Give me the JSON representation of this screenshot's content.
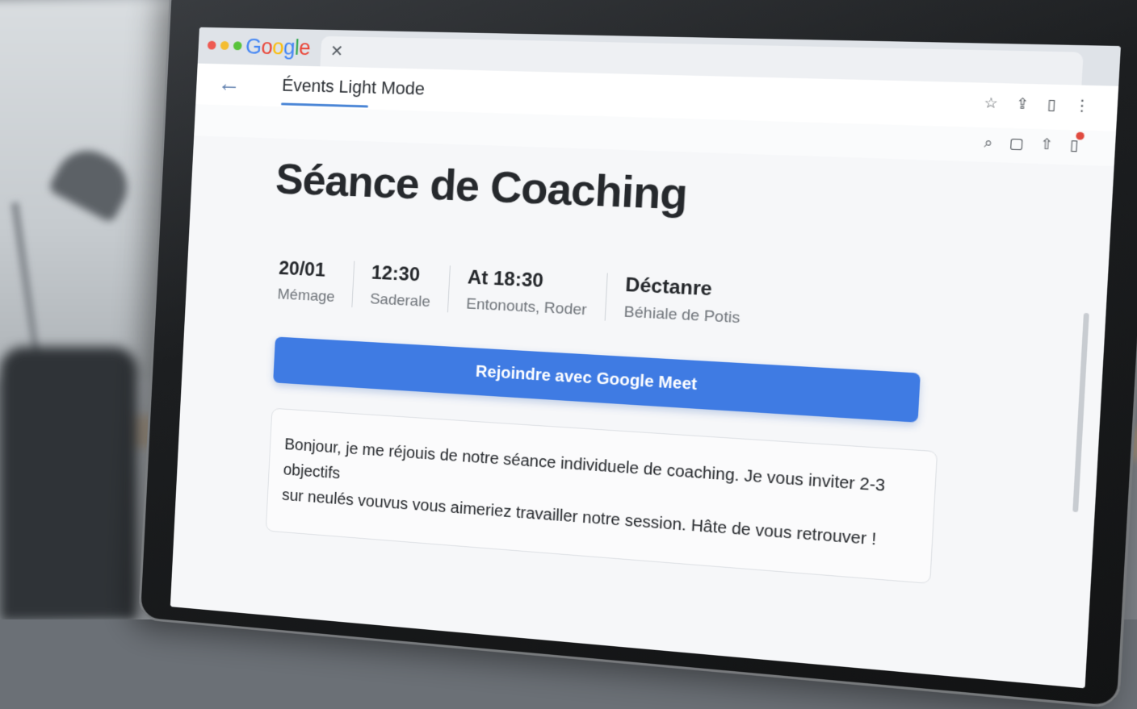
{
  "browser": {
    "brand_letters": [
      {
        "char": "G",
        "color": "#4285F4"
      },
      {
        "char": "o",
        "color": "#EA4335"
      },
      {
        "char": "o",
        "color": "#FBBC05"
      },
      {
        "char": "g",
        "color": "#4285F4"
      },
      {
        "char": "l",
        "color": "#34A853"
      },
      {
        "char": "e",
        "color": "#EA4335"
      }
    ],
    "tab_close_glyph": "✕",
    "toolbar_icons": [
      "star-icon",
      "share-icon",
      "tablet-icon",
      "more-icon"
    ],
    "action_icons": [
      "search-icon",
      "reader-icon",
      "share-out-icon",
      "notification-icon"
    ]
  },
  "page": {
    "back_glyph": "←",
    "tab_label": "Évents Light Mode",
    "title": "Séance de Coaching",
    "meta": [
      {
        "value": "20/01",
        "sub": "Mémage"
      },
      {
        "value": "12:30",
        "sub": "Saderale"
      },
      {
        "value": "At 18:30",
        "sub": "Entonouts, Roder"
      },
      {
        "value": "Déctanre",
        "sub": "Béhiale de Potis"
      }
    ],
    "join_button": "Rejoindre avec Google Meet",
    "note_line1": "Bonjour, je me réjouis de notre séance individuele de coaching. Je vous inviter 2-3 objectifs",
    "note_line2": "sur neulés vouvus vous aimeriez travailler notre session. Hâte de vous retrouver !"
  },
  "colors": {
    "accent": "#3f7be3",
    "tab_underline": "#4b86d6",
    "notification": "#e04a3f"
  }
}
